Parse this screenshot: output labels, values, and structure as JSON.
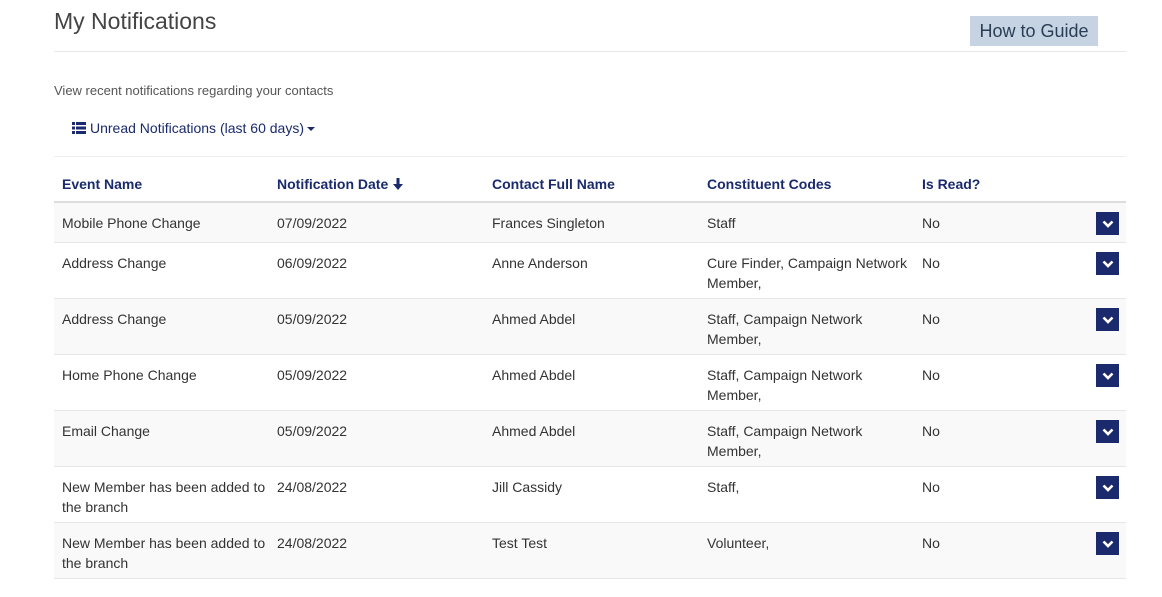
{
  "header": {
    "title": "My Notifications",
    "guide_button": "How to Guide"
  },
  "intro": "View recent notifications regarding your contacts",
  "filter": {
    "label": "Unread Notifications (last 60 days)",
    "icon": "list-icon"
  },
  "columns": {
    "event": "Event Name",
    "date": "Notification Date",
    "contact": "Contact Full Name",
    "codes": "Constituent Codes",
    "read": "Is Read?"
  },
  "rows": [
    {
      "event": "Mobile Phone Change",
      "date": "07/09/2022",
      "contact": "Frances Singleton",
      "codes": "Staff",
      "read": "No"
    },
    {
      "event": "Address Change",
      "date": "06/09/2022",
      "contact": "Anne Anderson",
      "codes": "Cure Finder, Campaign Network Member,",
      "read": "No"
    },
    {
      "event": "Address Change",
      "date": "05/09/2022",
      "contact": "Ahmed Abdel",
      "codes": "Staff, Campaign Network Member,",
      "read": "No"
    },
    {
      "event": "Home Phone Change",
      "date": "05/09/2022",
      "contact": "Ahmed Abdel",
      "codes": "Staff, Campaign Network Member,",
      "read": "No"
    },
    {
      "event": "Email Change",
      "date": "05/09/2022",
      "contact": "Ahmed Abdel",
      "codes": "Staff, Campaign Network Member,",
      "read": "No"
    },
    {
      "event": "New Member has been added to the branch",
      "date": "24/08/2022",
      "contact": "Jill Cassidy",
      "codes": "Staff,",
      "read": "No"
    },
    {
      "event": "New Member has been added to the branch",
      "date": "24/08/2022",
      "contact": "Test Test",
      "codes": "Volunteer,",
      "read": "No"
    }
  ],
  "colors": {
    "accent": "#1a2a6c",
    "guide_button_bg": "#c6d3e3"
  }
}
